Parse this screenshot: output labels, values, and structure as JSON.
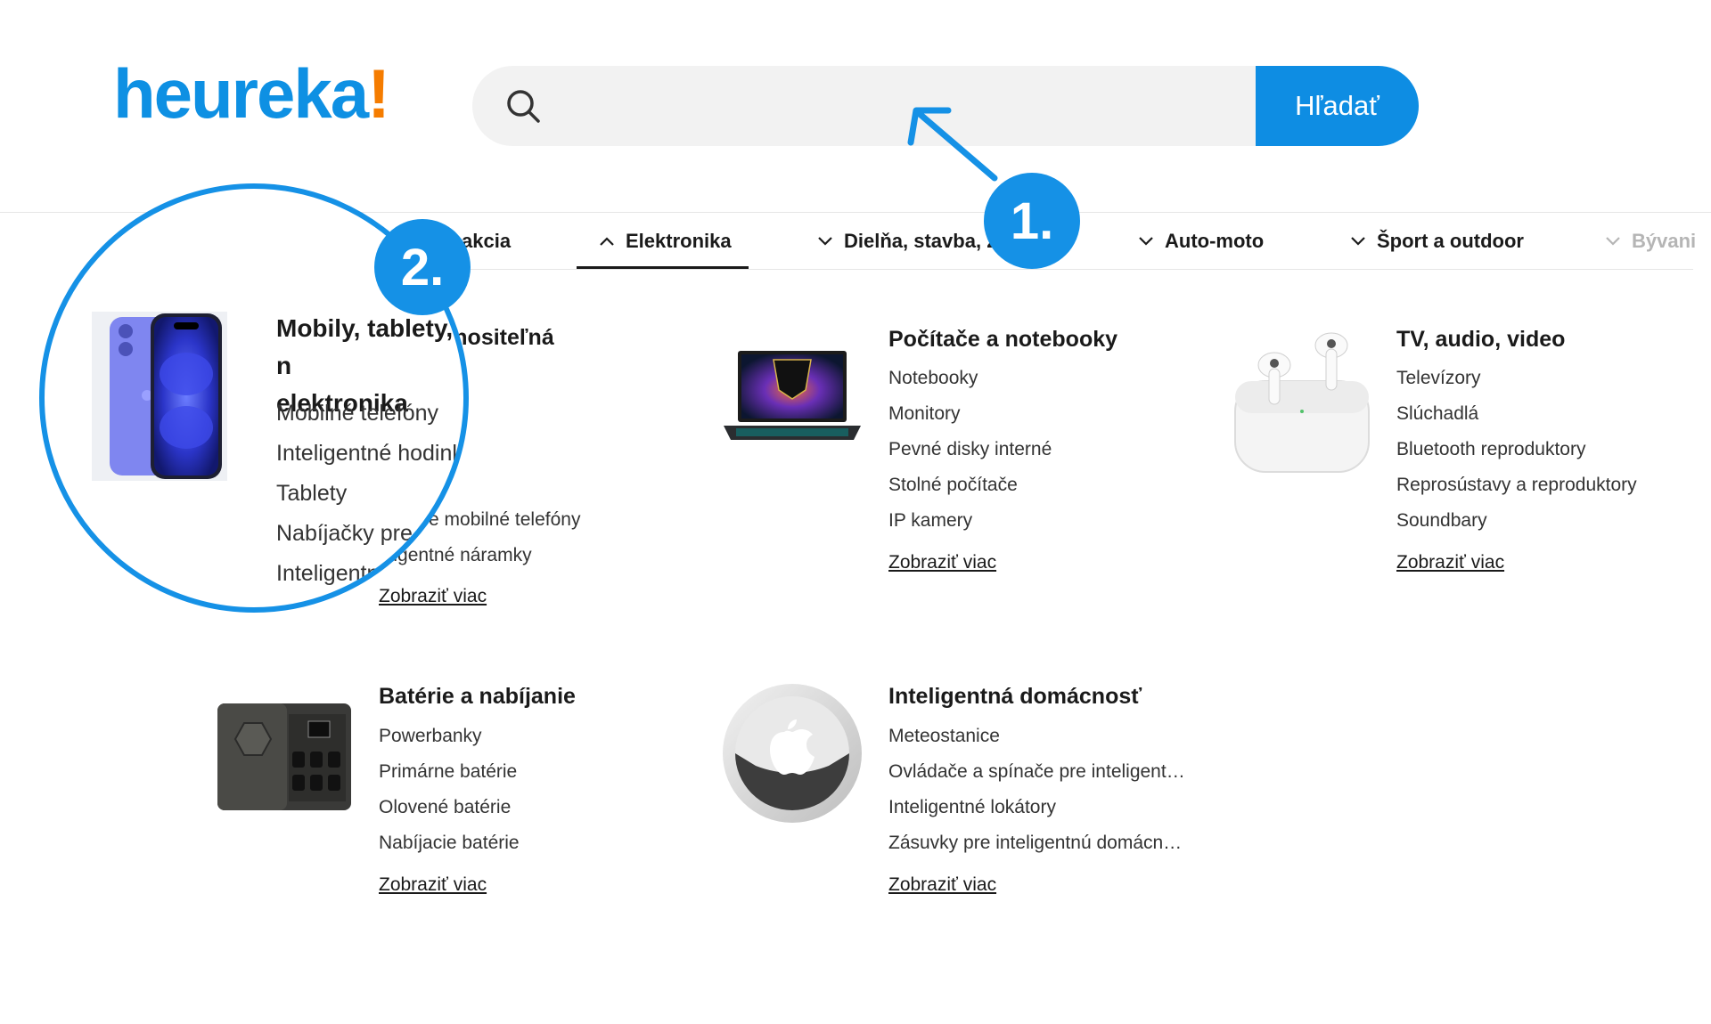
{
  "header": {
    "logo_text": "heureka",
    "logo_mark": "!",
    "search": {
      "placeholder": "",
      "button_label": "Hľadať"
    }
  },
  "tabs": [
    {
      "label": "akcia"
    },
    {
      "label": "Elektronika",
      "active": true
    },
    {
      "label": "Dielňa, stavba, z"
    },
    {
      "label": "Auto-moto"
    },
    {
      "label": "Šport a outdoor"
    },
    {
      "label": "Bývani"
    }
  ],
  "categories": [
    {
      "title_line1": "ablety, nositeľná",
      "title_line2": "ka",
      "items": [
        "efóny",
        "é hodinky",
        "",
        "cky pre mobilné telefóny",
        "eligentné náramky"
      ],
      "more": "Zobraziť viac"
    },
    {
      "title": "Počítače a notebooky",
      "items": [
        "Notebooky",
        "Monitory",
        "Pevné disky interné",
        "Stolné počítače",
        "IP kamery"
      ],
      "more": "Zobraziť viac"
    },
    {
      "title": "TV, audio, video",
      "items": [
        "Televízory",
        "Slúchadlá",
        "Bluetooth reproduktory",
        "Reprosústavy a reproduktory",
        "Soundbary"
      ],
      "more": "Zobraziť viac"
    },
    {
      "title": "Batérie a nabíjanie",
      "items": [
        "Powerbanky",
        "Primárne batérie",
        "Olovené batérie",
        "Nabíjacie batérie"
      ],
      "more": "Zobraziť viac"
    },
    {
      "title": "Inteligentná domácnosť",
      "items": [
        "Meteostanice",
        "Ovládače a spínače pre inteligent…",
        "Inteligentné lokátory",
        "Zásuvky pre inteligentnú domácn…"
      ],
      "more": "Zobraziť viac"
    }
  ],
  "magnifier": {
    "title_line1": "Mobily, tablety, n",
    "title_line2": "elektronika",
    "items": [
      "Mobilné telefóny",
      "Inteligentné hodinky",
      "Tablety",
      "Nabíjačky pre m",
      "Inteligentné"
    ]
  },
  "annotations": {
    "badge_1": "1.",
    "badge_2": "2."
  },
  "colors": {
    "brand_blue": "#0e8de3",
    "logo_orange": "#f57c00",
    "annotation_blue": "#1591e6"
  },
  "icons": [
    "search-icon",
    "chevron-up-icon",
    "chevron-down-icon",
    "arrow-icon"
  ]
}
